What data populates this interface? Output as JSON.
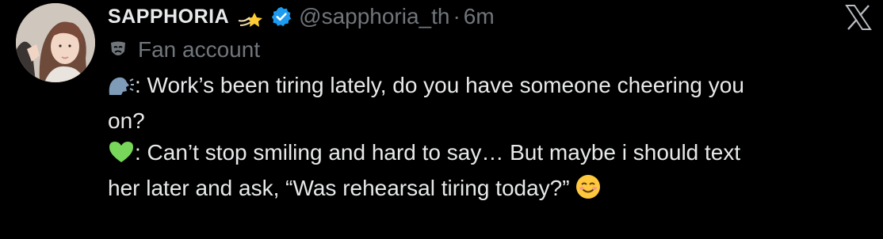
{
  "tweet": {
    "author": {
      "display_name": "SAPPHORIA",
      "name_emoji": "dizzy-emoji",
      "verified": true,
      "handle": "@sapphoria_th",
      "separator": "·",
      "time": "6m"
    },
    "label": {
      "icon": "theater-mask-icon",
      "text": "Fan account"
    },
    "body": {
      "line1_emoji": "speaking-head-emoji",
      "line1_text": ": Work’s been tiring lately, do you have someone cheering you",
      "line2_text": "on?",
      "line3_emoji": "green-heart-emoji",
      "line3_text": ": Can’t stop smiling and hard to say… But maybe i should text",
      "line4_text": "her later and ask, “Was rehearsal tiring today?”",
      "line4_emoji": "smiling-face-emoji"
    },
    "platform_logo": "x-logo-icon"
  },
  "colors": {
    "background": "#000000",
    "primary_text": "#e7e9ea",
    "secondary_text": "#71767b",
    "verified_badge": "#1d9bf0",
    "heart": "#78d65a"
  }
}
